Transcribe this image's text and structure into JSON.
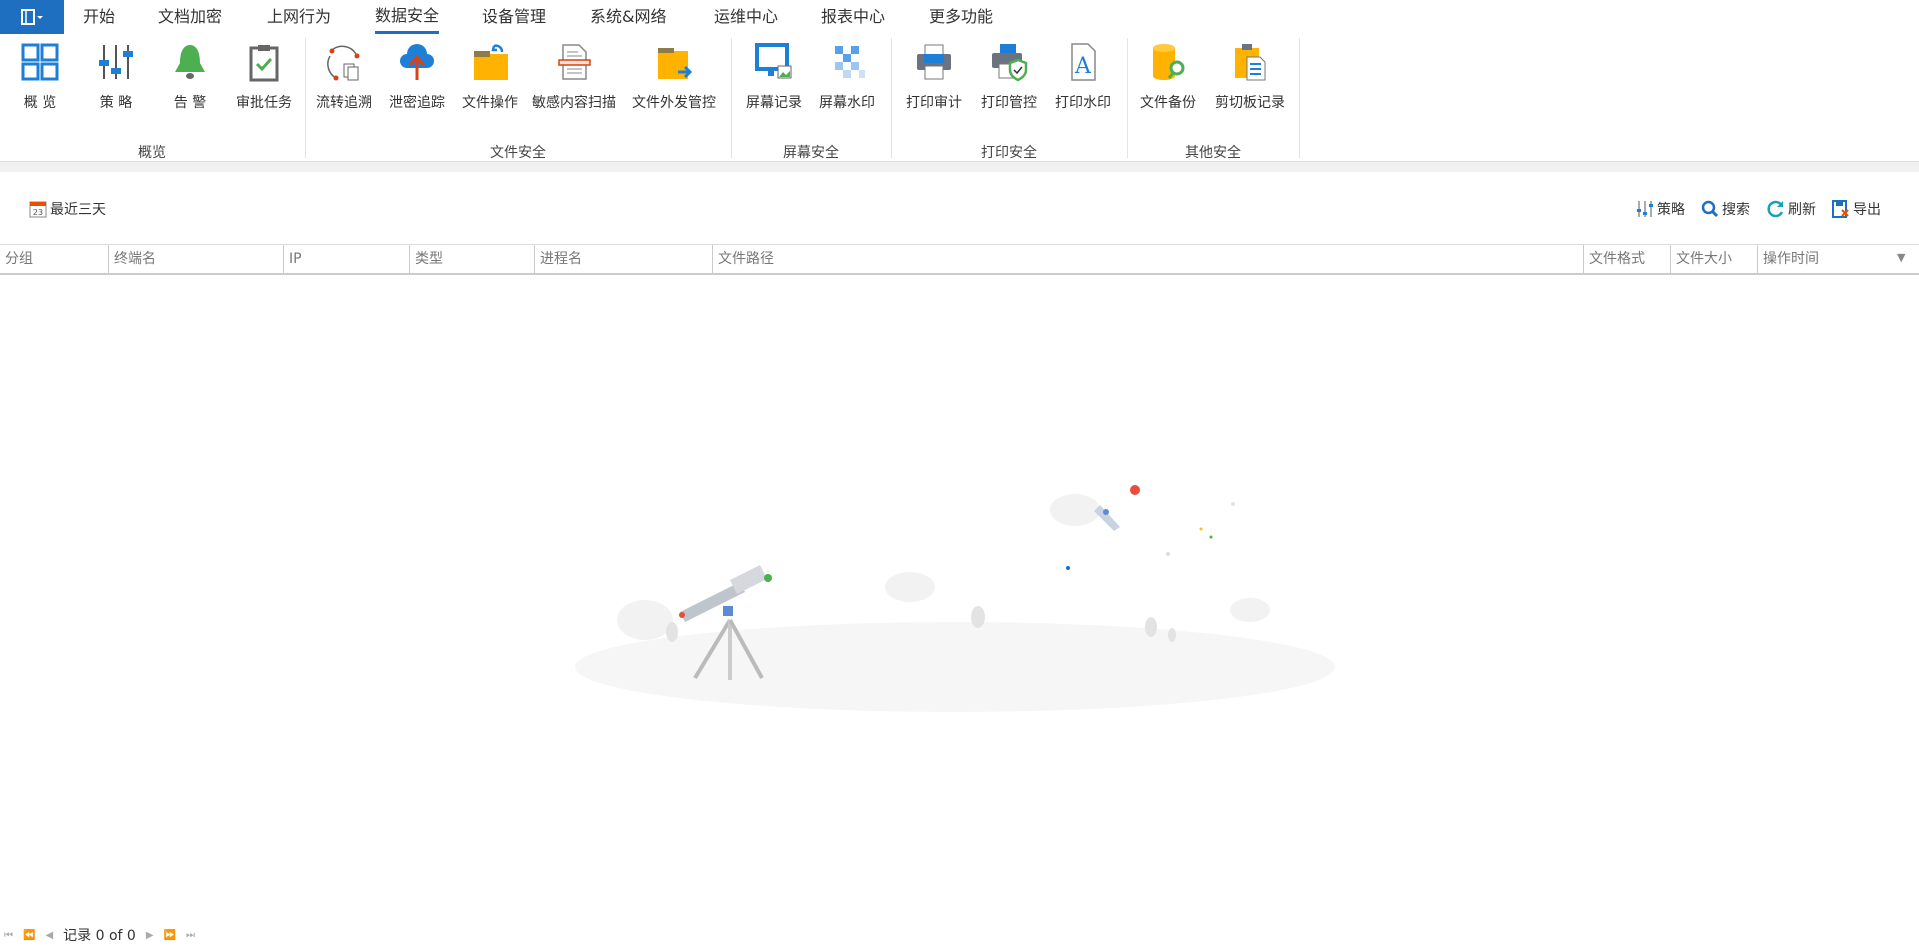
{
  "menu_tabs": [
    "开始",
    "文档加密",
    "上网行为",
    "数据安全",
    "设备管理",
    "系统&网络",
    "运维中心",
    "报表中心",
    "更多功能"
  ],
  "active_tab": "数据安全",
  "ribbon": {
    "groups": [
      "概览",
      "文件安全",
      "屏幕安全",
      "打印安全",
      "其他安全"
    ],
    "items": [
      "概 览",
      "策 略",
      "告 警",
      "审批任务",
      "流转追溯",
      "泄密追踪",
      "文件操作",
      "敏感内容扫描",
      "文件外发管控",
      "屏幕记录",
      "屏幕水印",
      "打印审计",
      "打印管控",
      "打印水印",
      "文件备份",
      "剪切板记录"
    ]
  },
  "toolbar": {
    "date_range": "最近三天",
    "calendar_day": "23",
    "policy": "策略",
    "search": "搜索",
    "refresh": "刷新",
    "export": "导出"
  },
  "table": {
    "columns": [
      "分组",
      "终端名",
      "IP",
      "类型",
      "进程名",
      "文件路径",
      "文件格式",
      "文件大小",
      "操作时间"
    ]
  },
  "pager": {
    "text": "记录 0 of 0"
  },
  "colors": {
    "accent": "#1e6fc0"
  }
}
